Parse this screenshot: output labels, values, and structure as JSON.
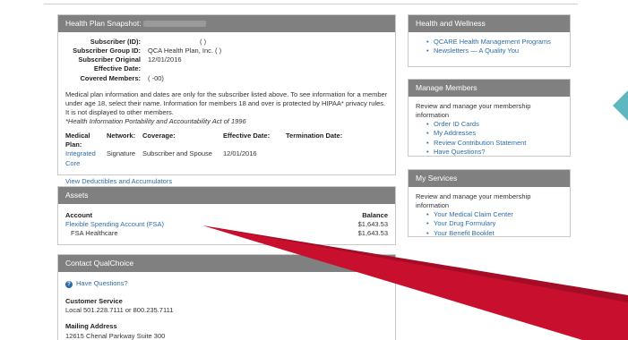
{
  "health_plan": {
    "title": "Health Plan Snapshot:",
    "fields": [
      {
        "label": "Subscriber (ID):",
        "value": "(          )"
      },
      {
        "label": "Subscriber Group ID:",
        "value": "QCA Health Plan, Inc. (          )"
      },
      {
        "label": "Subscriber Original",
        "value": "12/01/2016"
      },
      {
        "label": "Effective Date:",
        "value": ""
      },
      {
        "label": "Covered Members:",
        "value": "(                -00)"
      }
    ],
    "notice": "Medical plan information and dates are only for the subscriber listed above. To see information for a member under age 18, select their name. Information for members 18 and over is protected by HIPAA* privacy rules. It is not displayed to other members.",
    "hipaa_note": "*Health Information Portability and Accountability Act of 1996",
    "columns": {
      "plan": "Medical Plan:",
      "network": "Network:",
      "coverage": "Coverage:",
      "effective": "Effective Date:",
      "termination": "Termination Date:"
    },
    "row": {
      "plan": "Integrated Core",
      "network": "Signature",
      "coverage": "Subscriber and Spouse",
      "effective": "12/01/2016",
      "termination": ""
    },
    "deductibles_link": "View Deductibles and Accumulators"
  },
  "assets": {
    "title": "Assets",
    "col_account": "Account",
    "col_balance": "Balance",
    "rows": [
      {
        "account": "Flexible Spending Account (FSA)",
        "balance": "$1,643.53"
      },
      {
        "account": "FSA Healthcare",
        "balance": "$1,643.53"
      }
    ]
  },
  "contact": {
    "title": "Contact QualChoice",
    "questions": "Have Questions?",
    "cs_heading": "Customer Service",
    "cs_text": "Local 501.228.7111 or 800.235.7111",
    "mail_heading": "Mailing Address",
    "mail_text": "12615 Chenal Parkway Suite 300"
  },
  "wellness": {
    "title": "Health and Wellness",
    "links": [
      "QCARE Health Management Programs",
      "Newsletters — A Quality You"
    ]
  },
  "manage": {
    "title": "Manage Members",
    "intro": "Review and manage your membership information",
    "links": [
      "Order ID Cards",
      "My Addresses",
      "Review Contribution Statement",
      "Have Questions?"
    ]
  },
  "services": {
    "title": "My Services",
    "intro": "Review and manage your membership information",
    "links": [
      "Your Medical Claim Center",
      "Your Drug Formulary",
      "Your Benefit Booklet"
    ]
  },
  "colors": {
    "header": "#808080",
    "link": "#2d6ea8",
    "arrow": "#c8102e",
    "tab": "#5fb8c0"
  }
}
